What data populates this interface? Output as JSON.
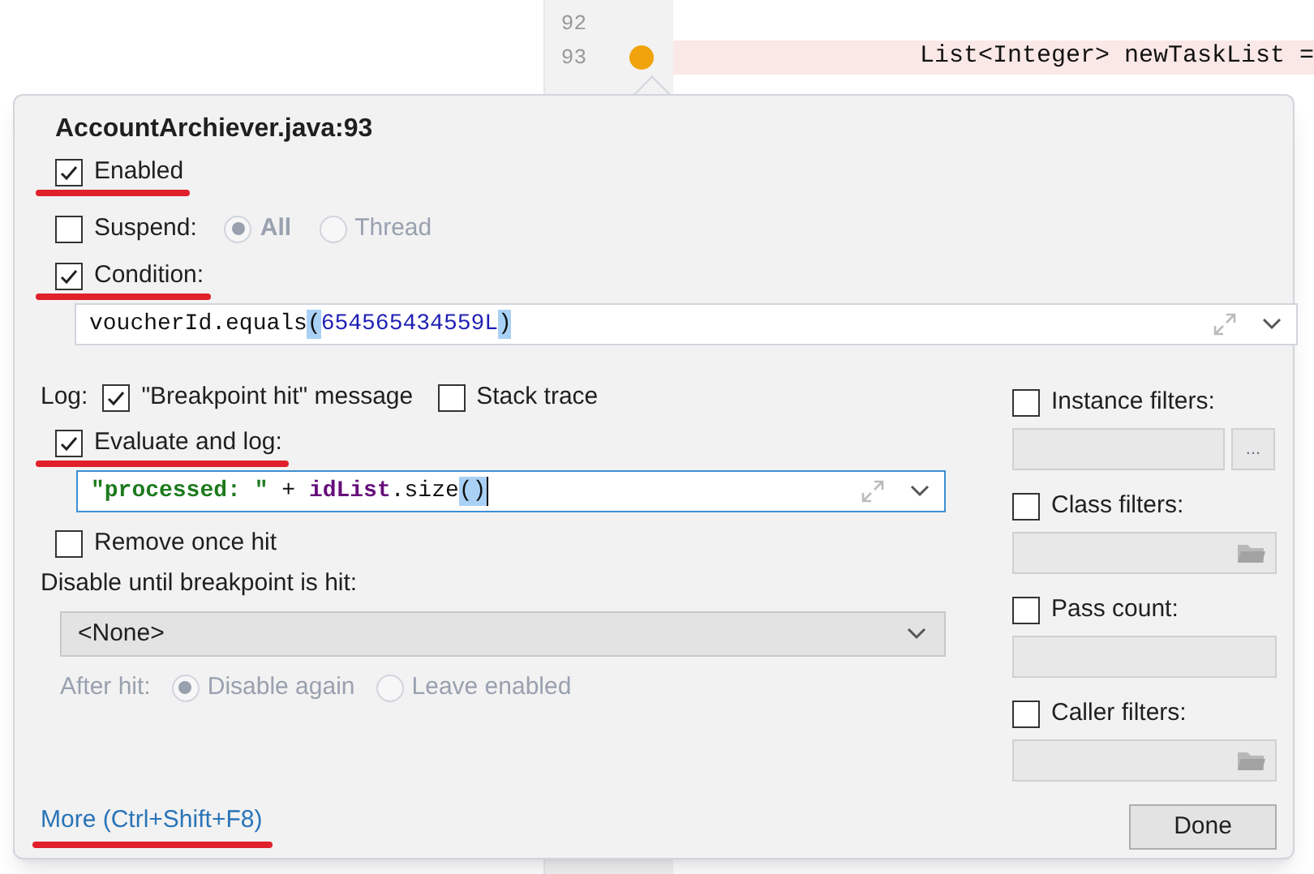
{
  "editor": {
    "lines": [
      {
        "number": "92",
        "breakpoint": false
      },
      {
        "number": "93",
        "breakpoint": true,
        "text": "List<Integer> newTaskList ="
      }
    ]
  },
  "popup": {
    "title": "AccountArchiever.java:93",
    "enabled": {
      "label": "Enabled",
      "checked": true,
      "annotated": true
    },
    "suspend": {
      "label": "Suspend:",
      "checked": false,
      "disabled": true,
      "radios": [
        {
          "label": "All",
          "selected": true
        },
        {
          "label": "Thread",
          "selected": false
        }
      ]
    },
    "condition": {
      "label": "Condition:",
      "checked": true,
      "annotated": true,
      "tokens": [
        {
          "text": "voucherId.equals",
          "kind": "plain"
        },
        {
          "text": "(",
          "kind": "paren"
        },
        {
          "text": "654565434559L",
          "kind": "number"
        },
        {
          "text": ")",
          "kind": "paren"
        }
      ]
    },
    "log": {
      "label": "Log:",
      "options": [
        {
          "label": "\"Breakpoint hit\" message",
          "checked": true
        },
        {
          "label": "Stack trace",
          "checked": false
        }
      ]
    },
    "evaluate": {
      "label": "Evaluate and log:",
      "checked": true,
      "annotated": true,
      "tokens": [
        {
          "text": "\"processed: \"",
          "kind": "string"
        },
        {
          "text": " + ",
          "kind": "plain"
        },
        {
          "text": "idList",
          "kind": "field"
        },
        {
          "text": ".size",
          "kind": "plain"
        },
        {
          "text": "()",
          "kind": "paren"
        }
      ]
    },
    "remove_once_hit": {
      "label": "Remove once hit",
      "checked": false
    },
    "disable_until": {
      "label": "Disable until breakpoint is hit:",
      "value": "<None>"
    },
    "after_hit": {
      "label": "After hit:",
      "disabled": true,
      "radios": [
        {
          "label": "Disable again",
          "selected": true
        },
        {
          "label": "Leave enabled",
          "selected": false
        }
      ]
    },
    "filters": [
      {
        "label": "Instance filters:",
        "checked": false,
        "kind": "browse",
        "button": "..."
      },
      {
        "label": "Class filters:",
        "checked": false,
        "kind": "folder"
      },
      {
        "label": "Pass count:",
        "checked": false,
        "kind": "plain"
      },
      {
        "label": "Caller filters:",
        "checked": false,
        "kind": "folder"
      }
    ],
    "more_link": {
      "label": "More (Ctrl+Shift+F8)",
      "annotated": true
    },
    "done_button": {
      "label": "Done"
    }
  }
}
